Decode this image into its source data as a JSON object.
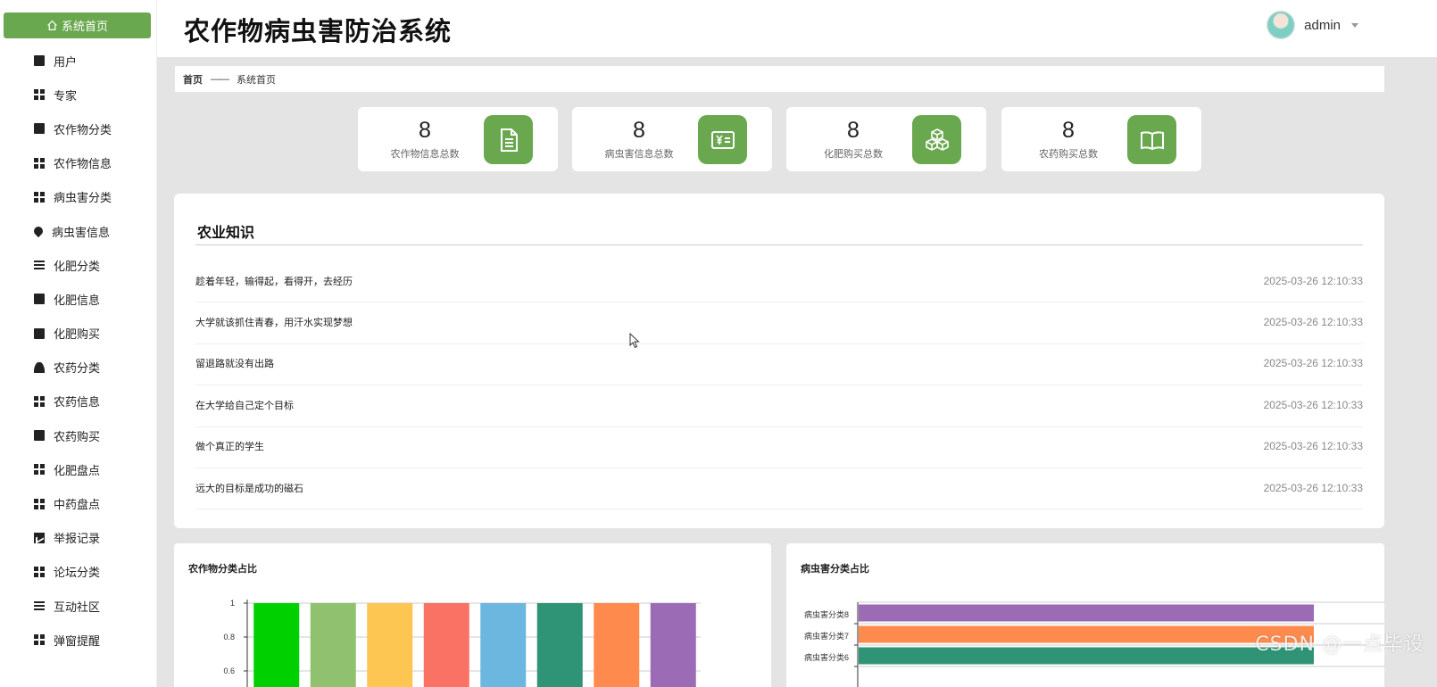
{
  "app": {
    "title": "农作物病虫害防治系统"
  },
  "user": {
    "name": "admin"
  },
  "sidebar": {
    "home_label": "系统首页",
    "items": [
      {
        "label": "用户",
        "icon": "clipboard-icon"
      },
      {
        "label": "专家",
        "icon": "grid-icon"
      },
      {
        "label": "农作物分类",
        "icon": "folder-icon"
      },
      {
        "label": "农作物信息",
        "icon": "grid-icon"
      },
      {
        "label": "病虫害分类",
        "icon": "grid-icon"
      },
      {
        "label": "病虫害信息",
        "icon": "pin-icon"
      },
      {
        "label": "化肥分类",
        "icon": "list-icon"
      },
      {
        "label": "化肥信息",
        "icon": "stamp-icon"
      },
      {
        "label": "化肥购买",
        "icon": "clipboard-check-icon"
      },
      {
        "label": "农药分类",
        "icon": "person-icon"
      },
      {
        "label": "农药信息",
        "icon": "grid-icon"
      },
      {
        "label": "农药购买",
        "icon": "books-icon"
      },
      {
        "label": "化肥盘点",
        "icon": "grid-icon"
      },
      {
        "label": "中药盘点",
        "icon": "grid-icon"
      },
      {
        "label": "举报记录",
        "icon": "chart-icon"
      },
      {
        "label": "论坛分类",
        "icon": "grid-icon"
      },
      {
        "label": "互动社区",
        "icon": "list-icon"
      },
      {
        "label": "弹窗提醒",
        "icon": "grid-icon"
      }
    ]
  },
  "breadcrumb": {
    "home": "首页",
    "separator": "——",
    "current": "系统首页"
  },
  "stats": [
    {
      "value": "8",
      "label": "农作物信息总数",
      "icon": "document-icon"
    },
    {
      "value": "8",
      "label": "病虫害信息总数",
      "icon": "yen-card-icon"
    },
    {
      "value": "8",
      "label": "化肥购买总数",
      "icon": "cubes-icon"
    },
    {
      "value": "8",
      "label": "农药购买总数",
      "icon": "book-icon"
    }
  ],
  "knowledge": {
    "title": "农业知识",
    "items": [
      {
        "title": "趁着年轻，输得起，看得开，去经历",
        "date": "2025-03-26 12:10:33"
      },
      {
        "title": "大学就该抓住青春，用汗水实现梦想",
        "date": "2025-03-26 12:10:33"
      },
      {
        "title": "留退路就没有出路",
        "date": "2025-03-26 12:10:33"
      },
      {
        "title": "在大学给自己定个目标",
        "date": "2025-03-26 12:10:33"
      },
      {
        "title": "做个真正的学生",
        "date": "2025-03-26 12:10:33"
      },
      {
        "title": "远大的目标是成功的磁石",
        "date": "2025-03-26 12:10:33"
      }
    ]
  },
  "chart_data": [
    {
      "type": "bar",
      "title": "农作物分类占比",
      "y_ticks": [
        "1",
        "0.8",
        "0.6"
      ],
      "ylim": [
        0,
        1
      ],
      "values": [
        1,
        1,
        1,
        1,
        1,
        1,
        1,
        1
      ],
      "colors": [
        "#00d000",
        "#8fc16f",
        "#fdc552",
        "#f97263",
        "#6cb7df",
        "#2f9476",
        "#fe8b4d",
        "#9b6bb6"
      ]
    },
    {
      "type": "bar",
      "orientation": "horizontal",
      "title": "病虫害分类占比",
      "categories": [
        "病虫害分类8",
        "病虫害分类7",
        "病虫害分类6"
      ],
      "values": [
        1,
        1,
        1
      ],
      "colors": [
        "#9b6bb6",
        "#fe8b4d",
        "#2f9476"
      ]
    }
  ],
  "watermark": "CSDN @一点毕设",
  "colors": {
    "accent": "#6aa84f"
  }
}
